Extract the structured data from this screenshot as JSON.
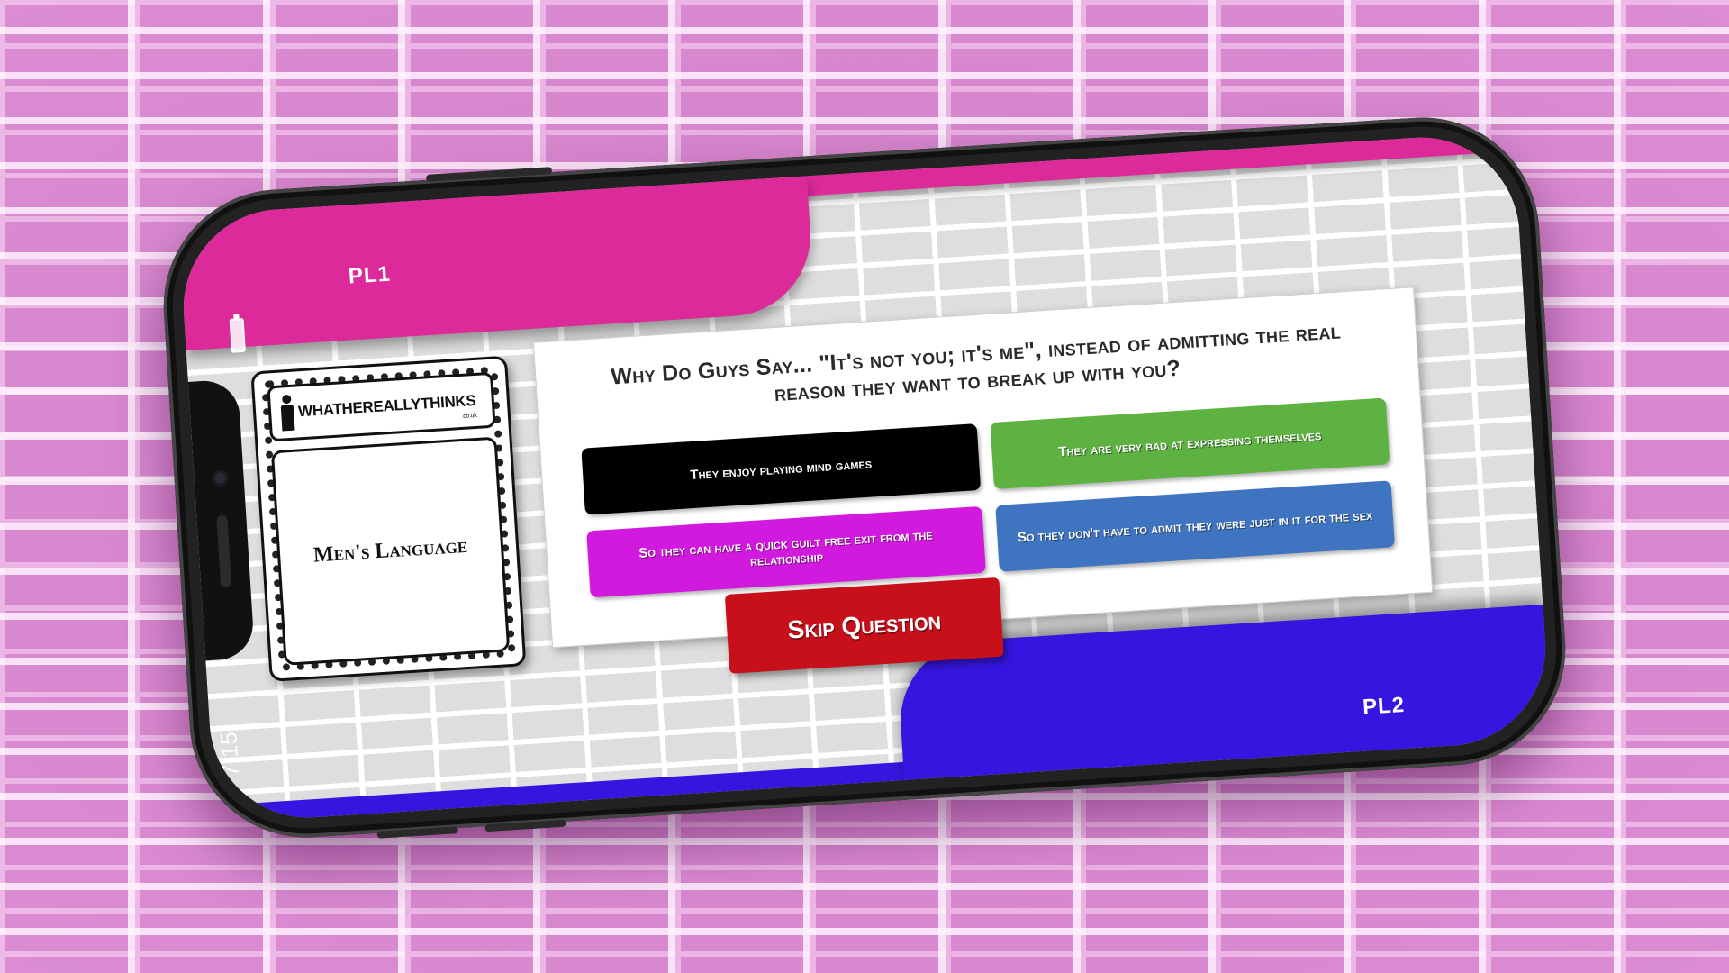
{
  "app": {
    "brand_name": "WHATHEREALLYTHINKS",
    "brand_domain": ".co.uk"
  },
  "players": {
    "pl1_label": "PL1",
    "pl2_label": "PL2"
  },
  "status_bar": {
    "time": "7:15"
  },
  "card": {
    "category": "Men's Language"
  },
  "question": {
    "text": "Why Do Guys Say... \"It's not you; it's me\", instead of admitting the real reason they want to break up with you?"
  },
  "answers": [
    {
      "label": "They enjoy playing mind games",
      "color": "#000000"
    },
    {
      "label": "They are very bad at expressing themselves",
      "color": "#5db241"
    },
    {
      "label": "So they can have a quick guilt free exit from the relationship",
      "color": "#d21adf"
    },
    {
      "label": "So they don't have to admit they were just in it for the sex",
      "color": "#3f75c0"
    }
  ],
  "actions": {
    "skip_label": "Skip Question"
  },
  "colors": {
    "pl1": "#dc2a9a",
    "pl2": "#3516e0",
    "skip": "#c8101a",
    "background_wall": "#d98cd0"
  }
}
